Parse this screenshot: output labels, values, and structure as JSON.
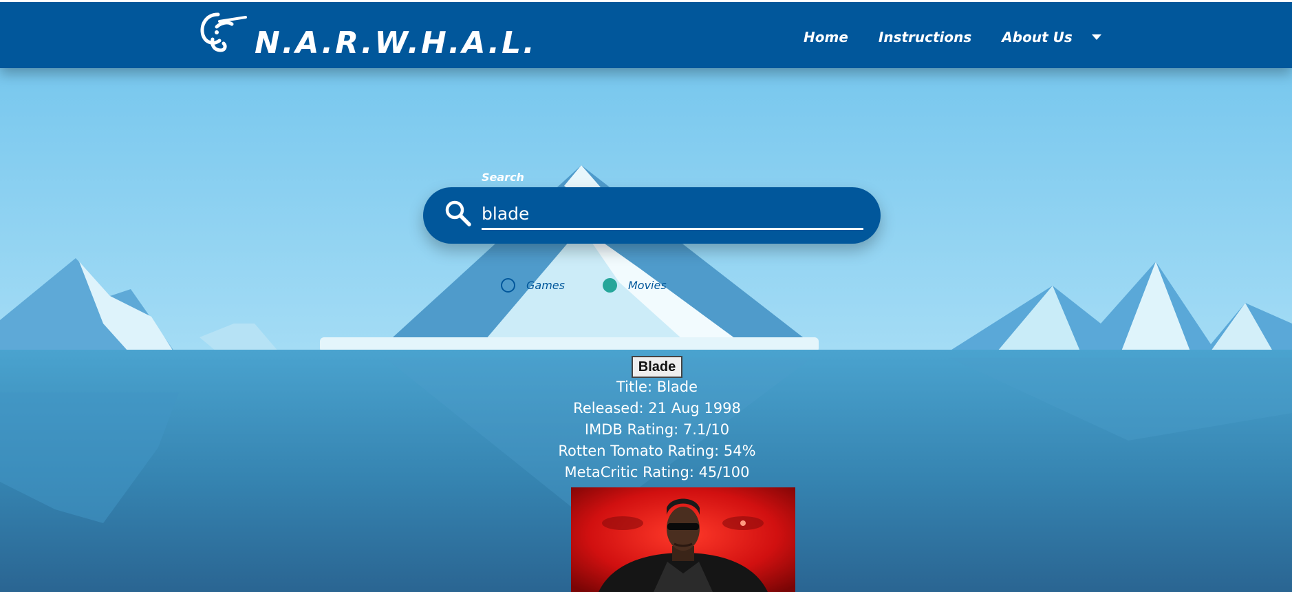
{
  "brand": {
    "name": "N.A.R.W.H.A.L.",
    "logo_icon": "narwhal-logo-icon"
  },
  "nav": {
    "items": [
      {
        "label": "Home"
      },
      {
        "label": "Instructions"
      },
      {
        "label": "About Us"
      }
    ],
    "dropdown_icon": "caret-down-icon"
  },
  "search": {
    "label": "Search",
    "value": "blade",
    "icon": "search-icon"
  },
  "categories": {
    "options": [
      {
        "label": "Games",
        "selected": false
      },
      {
        "label": "Movies",
        "selected": true
      }
    ]
  },
  "result": {
    "button_label": "Blade",
    "title_line": "Title: Blade",
    "released_line": "Released: 21 Aug 1998",
    "imdb_line": "IMDB Rating: 7.1/10",
    "rotten_line": "Rotten Tomato Rating: 54%",
    "metacritic_line": "MetaCritic Rating: 45/100"
  },
  "colors": {
    "primary": "#01579b",
    "accent": "#26a69a",
    "sky": "#7cc9ee",
    "water": "#3a8fbd"
  }
}
